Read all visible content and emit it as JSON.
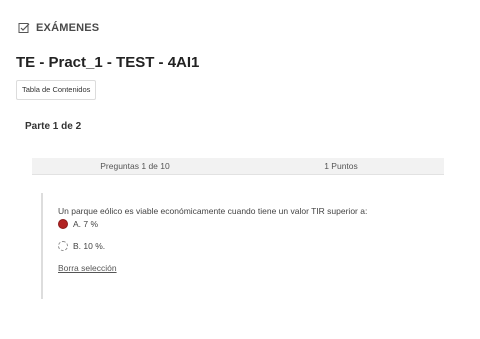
{
  "header": {
    "section_title": "EXÁMENES",
    "icon": "checklist-icon"
  },
  "exam": {
    "title": "TE - Pract_1 - TEST - 4AI1"
  },
  "toolbar": {
    "toc_label": "Tabla de Contenidos"
  },
  "part": {
    "label": "Parte 1 de 2"
  },
  "question_bar": {
    "progress": "Preguntas 1 de 10",
    "points": "1 Puntos"
  },
  "question": {
    "text": "Un parque eólico es viable económicamente cuando tiene un valor TIR superior a:",
    "options": [
      {
        "label": "A. 7 %",
        "selected": true
      },
      {
        "label": "B. 10 %.",
        "selected": false
      }
    ],
    "clear_label": "Borra selección"
  },
  "colors": {
    "selected_radio": "#b22222"
  }
}
